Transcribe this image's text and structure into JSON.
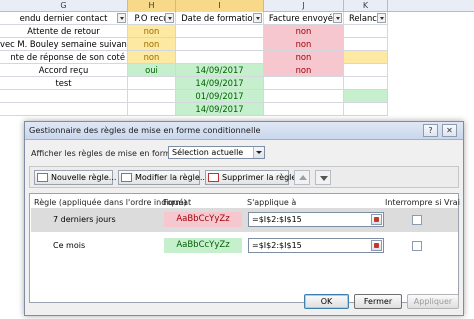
{
  "spreadsheet": {
    "columns": [
      "G",
      "H",
      "I",
      "J",
      "K"
    ],
    "header": {
      "g": "endu dernier contact",
      "h": "P.O recu",
      "i": "Date de formation",
      "j": "Facture envoyée",
      "k": "Relance"
    },
    "rows": [
      {
        "g": "Attente de retour",
        "h": "non",
        "i": "",
        "j": "non",
        "k": ""
      },
      {
        "g": "vec M. Bouley semaine suivante",
        "h": "non",
        "i": "",
        "j": "non",
        "k": ""
      },
      {
        "g": "nte de réponse de son coté",
        "h": "non",
        "i": "",
        "j": "non",
        "k": ""
      },
      {
        "g": "Accord reçu",
        "h": "oui",
        "i": "14/09/2017",
        "j": "non",
        "k": ""
      },
      {
        "g": "test",
        "h": "",
        "i": "14/09/2017",
        "j": "",
        "k": ""
      },
      {
        "g": "",
        "h": "",
        "i": "01/09/2017",
        "j": "",
        "k": ""
      },
      {
        "g": "",
        "h": "",
        "i": "14/09/2017",
        "j": "",
        "k": ""
      }
    ],
    "colors": {
      "yellow": "#fde9a1",
      "pink": "#f6c7ce",
      "green": "#c6efce"
    }
  },
  "dialog": {
    "title": "Gestionnaire des règles de mise en forme conditionnelle",
    "help_icon": "question-mark-icon",
    "close_icon": "close-x-icon",
    "show_rules_label": "Afficher les règles de mise en forme pour :",
    "show_rules_value": "Sélection actuelle",
    "toolbar": {
      "new_rule": "Nouvelle règle...",
      "edit_rule": "Modifier la règle...",
      "delete_rule": "Supprimer la règle"
    },
    "columns": {
      "rule": "Règle (appliquée dans l'ordre indiqué)",
      "format": "Format",
      "applies_to": "S'applique à",
      "stop_if_true": "Interrompre si Vrai"
    },
    "rules": [
      {
        "name": "7 derniers jours",
        "format_preview": "AaBbCcYyZz",
        "applies_to": "=$I$2:$I$15",
        "stop_if_true": false,
        "format_color": "#f6c7ce",
        "text_color": "#9c0006"
      },
      {
        "name": "Ce mois",
        "format_preview": "AaBbCcYyZz",
        "applies_to": "=$I$2:$I$15",
        "stop_if_true": false,
        "format_color": "#c6efce",
        "text_color": "#006100"
      }
    ],
    "buttons": {
      "ok": "OK",
      "close": "Fermer",
      "apply": "Appliquer"
    }
  }
}
